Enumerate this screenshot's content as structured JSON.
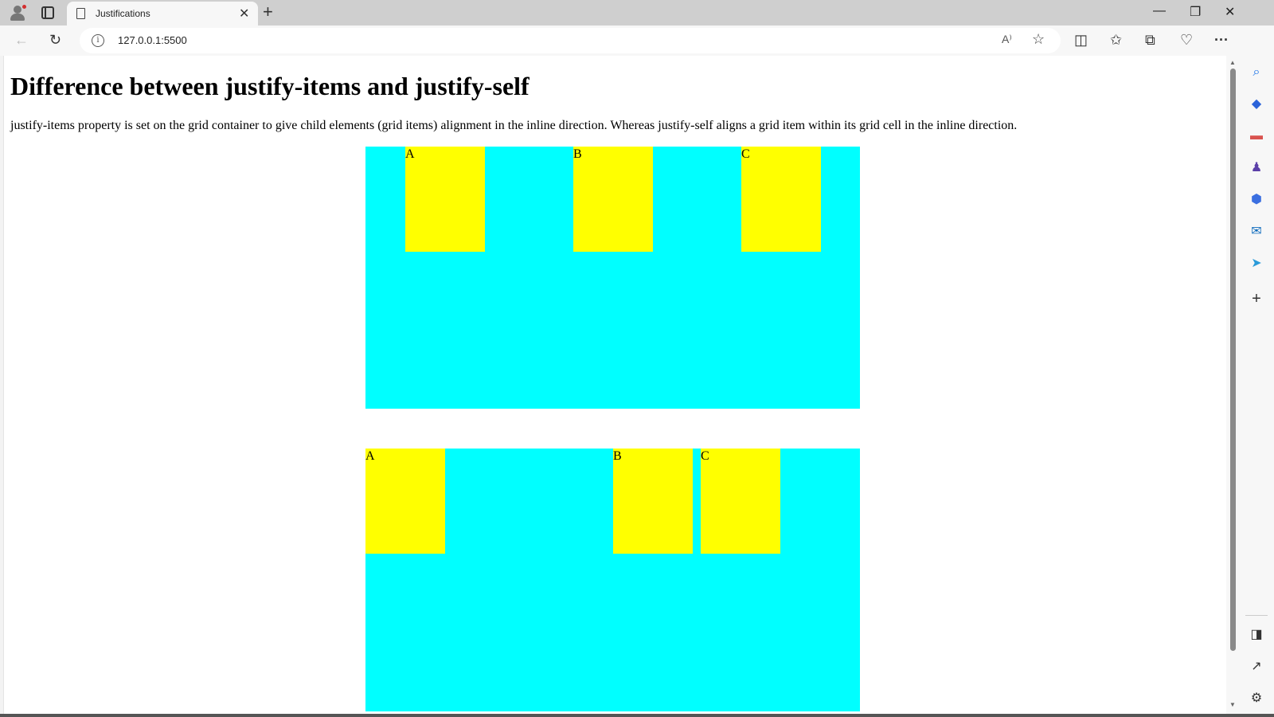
{
  "browser": {
    "tab_title": "Justifications",
    "tab_close": "✕",
    "new_tab": "+",
    "window_controls": {
      "minimize": "—",
      "restore": "❐",
      "close": "✕"
    },
    "nav": {
      "back": "←",
      "refresh": "↻"
    },
    "address": {
      "url": "127.0.0.1:5500",
      "info_icon": "i",
      "read_aloud": "A⁾",
      "favorite": "☆"
    },
    "toolbar_right": {
      "split_screen": "◫",
      "favorites": "✩",
      "collections": "⧉",
      "browser_essentials": "♡",
      "more": "···"
    },
    "copilot_icon": "◆"
  },
  "sidebar": [
    {
      "name": "search-icon",
      "glyph": "⌕",
      "color": "#1a73e8"
    },
    {
      "name": "shopping-icon",
      "glyph": "◆",
      "color": "#2b63d9"
    },
    {
      "name": "tools-icon",
      "glyph": "▬",
      "color": "#d9534f"
    },
    {
      "name": "games-icon",
      "glyph": "♟",
      "color": "#5b3fa8"
    },
    {
      "name": "microsoft365-icon",
      "glyph": "⬢",
      "color": "#3b6fe0"
    },
    {
      "name": "outlook-icon",
      "glyph": "✉",
      "color": "#0f6cbd"
    },
    {
      "name": "drop-icon",
      "glyph": "➤",
      "color": "#2b9bd9"
    },
    {
      "name": "add-icon",
      "glyph": "+",
      "color": "#333333"
    },
    {
      "name": "sidebar-toggle-icon",
      "glyph": "◨",
      "color": "#333333"
    },
    {
      "name": "open-external-icon",
      "glyph": "↗",
      "color": "#333333"
    },
    {
      "name": "settings-icon",
      "glyph": "⚙",
      "color": "#333333"
    }
  ],
  "page": {
    "heading": "Difference between justify-items and justify-self",
    "description": "justify-items property is set on the grid container to give child elements (grid items) alignment in the inline direction. Whereas justify-self aligns a grid item within its grid cell in the inline direction.",
    "grid1": {
      "items": [
        "A",
        "B",
        "C"
      ]
    },
    "grid2": {
      "items": [
        "A",
        "B",
        "C"
      ]
    },
    "colors": {
      "grid_bg": "#00ffff",
      "item_bg": "#ffff00"
    }
  }
}
